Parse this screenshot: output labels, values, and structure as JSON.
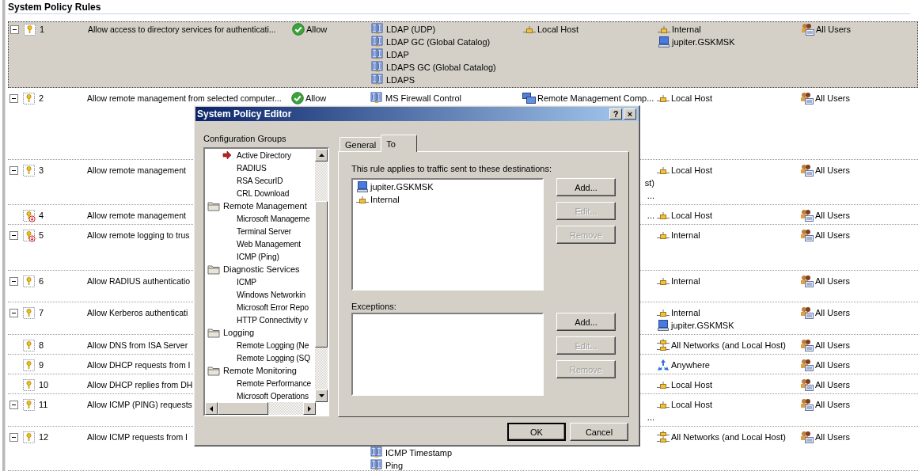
{
  "table": {
    "title": "System Policy Rules",
    "rows": [
      {
        "selected": true,
        "expanded": true,
        "arrow_badge": false,
        "order": "1",
        "name": "Allow access to directory services for authenticati...",
        "action": "Allow",
        "protocols": [
          "LDAP (UDP)",
          "LDAP GC (Global Catalog)",
          "LDAP",
          "LDAPS GC (Global Catalog)",
          "LDAPS"
        ],
        "from": [
          {
            "text": "Local Host",
            "kind": "network"
          }
        ],
        "to": [
          {
            "text": "Internal",
            "kind": "network"
          },
          {
            "text": "jupiter.GSKMSK",
            "kind": "computer"
          }
        ],
        "users": "All Users"
      },
      {
        "selected": false,
        "expanded": true,
        "arrow_badge": false,
        "order": "2",
        "name": "Allow remote management from selected computer...",
        "action": "Allow",
        "protocols": [
          "MS Firewall Control"
        ],
        "from": [
          {
            "text": "Remote Management Comp...",
            "kind": "computers"
          }
        ],
        "to": [
          {
            "text": "Local Host",
            "kind": "network"
          }
        ],
        "users": "All Users"
      },
      {
        "selected": false,
        "expanded": true,
        "arrow_badge": false,
        "order": "3",
        "name": "Allow remote management",
        "from_fragments": [
          "st)",
          "..."
        ],
        "to": [
          {
            "text": "Local Host",
            "kind": "network"
          }
        ],
        "users": "All Users"
      },
      {
        "selected": false,
        "arrow_badge": true,
        "order": "4",
        "name": "Allow remote management",
        "from_fragments": [
          "..."
        ],
        "to": [
          {
            "text": "Local Host",
            "kind": "network"
          }
        ],
        "users": "All Users"
      },
      {
        "selected": false,
        "expanded": true,
        "arrow_badge": true,
        "order": "5",
        "name": "Allow remote logging to trus",
        "to": [
          {
            "text": "Internal",
            "kind": "network"
          }
        ],
        "users": "All Users"
      },
      {
        "selected": false,
        "expanded": true,
        "arrow_badge": false,
        "order": "6",
        "name": "Allow RADIUS authenticatio",
        "to": [
          {
            "text": "Internal",
            "kind": "network"
          }
        ],
        "users": "All Users"
      },
      {
        "selected": false,
        "expanded": true,
        "arrow_badge": false,
        "order": "7",
        "name": "Allow Kerberos authenticati",
        "to": [
          {
            "text": "Internal",
            "kind": "network"
          },
          {
            "text": "jupiter.GSKMSK",
            "kind": "computer"
          }
        ],
        "users": "All Users"
      },
      {
        "selected": false,
        "arrow_badge": false,
        "order": "8",
        "name": "Allow DNS from ISA Server",
        "to": [
          {
            "text": "All Networks (and Local Host)",
            "kind": "networks"
          }
        ],
        "users": "All Users"
      },
      {
        "selected": false,
        "arrow_badge": false,
        "order": "9",
        "name": "Allow DHCP requests from I",
        "to": [
          {
            "text": "Anywhere",
            "kind": "anywhere"
          }
        ],
        "users": "All Users"
      },
      {
        "selected": false,
        "arrow_badge": false,
        "order": "10",
        "name": "Allow DHCP replies from DH",
        "to": [
          {
            "text": "Local Host",
            "kind": "network"
          }
        ],
        "users": "All Users"
      },
      {
        "selected": false,
        "expanded": true,
        "arrow_badge": false,
        "order": "11",
        "name": "Allow ICMP (PING) requests",
        "from_fragments": [
          "..."
        ],
        "to": [
          {
            "text": "Local Host",
            "kind": "network"
          }
        ],
        "users": "All Users"
      },
      {
        "selected": false,
        "expanded": true,
        "arrow_badge": false,
        "order": "12",
        "name": "Allow ICMP requests from I",
        "protocols": [
          "ICMP Timestamp",
          "Ping"
        ],
        "to": [
          {
            "text": "All Networks (and Local Host)",
            "kind": "networks"
          }
        ],
        "users": "All Users"
      }
    ]
  },
  "dialog": {
    "title": "System Policy Editor",
    "help_glyph": "?",
    "close_glyph": "×",
    "groups_label": "Configuration Groups",
    "tree": [
      {
        "children": [
          {
            "label": "Active Directory",
            "selected": true
          },
          {
            "label": "RADIUS",
            "selected": false
          },
          {
            "label": "RSA SecurID",
            "selected": false
          },
          {
            "label": "CRL Download",
            "selected": false
          }
        ]
      },
      {
        "label": "Remote Management",
        "children": [
          {
            "label": "Microsoft Manageme",
            "selected": false
          },
          {
            "label": "Terminal Server",
            "selected": false
          },
          {
            "label": "Web Management",
            "selected": false
          },
          {
            "label": "ICMP (Ping)",
            "selected": false
          }
        ]
      },
      {
        "label": "Diagnostic Services",
        "children": [
          {
            "label": "ICMP",
            "selected": false
          },
          {
            "label": "Windows Networkin",
            "selected": false
          },
          {
            "label": "Microsoft Error Repo",
            "selected": false
          },
          {
            "label": "HTTP Connectivity v",
            "selected": false
          }
        ]
      },
      {
        "label": "Logging",
        "children": [
          {
            "label": "Remote Logging (Ne",
            "selected": false
          },
          {
            "label": "Remote Logging (SQ",
            "selected": false
          }
        ]
      },
      {
        "label": "Remote Monitoring",
        "children": [
          {
            "label": "Remote Performance",
            "selected": false
          },
          {
            "label": "Microsoft Operations",
            "selected": false
          }
        ]
      }
    ],
    "tabs": [
      {
        "label": "General",
        "selected": false
      },
      {
        "label": "To",
        "selected": true
      }
    ],
    "destinations_label": "This rule applies to traffic sent to these destinations:",
    "destinations": [
      {
        "text": "jupiter.GSKMSK",
        "kind": "computer"
      },
      {
        "text": "Internal",
        "kind": "network"
      }
    ],
    "destination_buttons": [
      {
        "label": "Add...",
        "disabled": false
      },
      {
        "label": "Edit...",
        "disabled": true
      },
      {
        "label": "Remove",
        "disabled": true
      }
    ],
    "exceptions_label": "Exceptions:",
    "exception_buttons": [
      {
        "label": "Add...",
        "disabled": false
      },
      {
        "label": "Edit...",
        "disabled": true
      },
      {
        "label": "Remove",
        "disabled": true
      }
    ],
    "footer_buttons": [
      {
        "label": "OK",
        "default": true
      },
      {
        "label": "Cancel",
        "default": false
      }
    ]
  }
}
